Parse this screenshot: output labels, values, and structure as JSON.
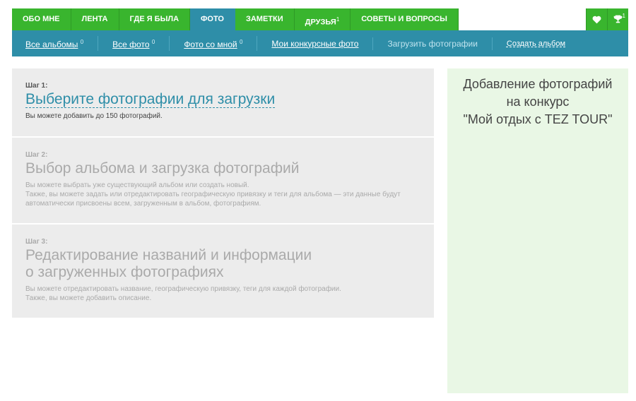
{
  "topnav": {
    "tabs": [
      {
        "label": "ОБО МНЕ"
      },
      {
        "label": "ЛЕНТА"
      },
      {
        "label": "ГДЕ Я БЫЛА"
      },
      {
        "label": "ФОТО"
      },
      {
        "label": "ЗАМЕТКИ"
      },
      {
        "label": "ДРУЗЬЯ",
        "badge": "1"
      },
      {
        "label": "СОВЕТЫ И ВОПРОСЫ"
      }
    ],
    "trophy_badge": "1"
  },
  "subnav": {
    "all_albums": {
      "label": "Все альбомы",
      "count": "0"
    },
    "all_photos": {
      "label": "Все фото",
      "count": "0"
    },
    "photos_with_me": {
      "label": "Фото со мной",
      "count": "0"
    },
    "contest_photos": {
      "label": "Мои конкурсные фото"
    },
    "upload_photos": {
      "label": "Загрузить фотографии"
    },
    "create_album": {
      "label": "Создать альбом"
    }
  },
  "steps": [
    {
      "label": "Шаг 1:",
      "title": "Выберите фотографии для загрузки",
      "desc_lines": [
        "Вы можете добавить до 150 фотографий."
      ]
    },
    {
      "label": "Шаг 2:",
      "title": "Выбор альбома и загрузка фотографий",
      "desc_lines": [
        "Вы можете выбрать уже существующий альбом или создать новый.",
        "Также, вы можете задать или отредактировать географическую привязку и теги для альбома — эти данные будут",
        "автоматически присвоены всем, загруженным в альбом, фотографиям."
      ]
    },
    {
      "label": "Шаг 3:",
      "title_lines": [
        "Редактирование названий и информации",
        "о загруженных фотографиях"
      ],
      "desc_lines": [
        "Вы можете отредактировать название, географическую привязку, теги для каждой фотографии.",
        "Также, вы можете добавить описание."
      ]
    }
  ],
  "contest": {
    "lines": [
      "Добавление фотографий",
      "на конкурс",
      "\"Мой отдых с TEZ TOUR\""
    ]
  }
}
